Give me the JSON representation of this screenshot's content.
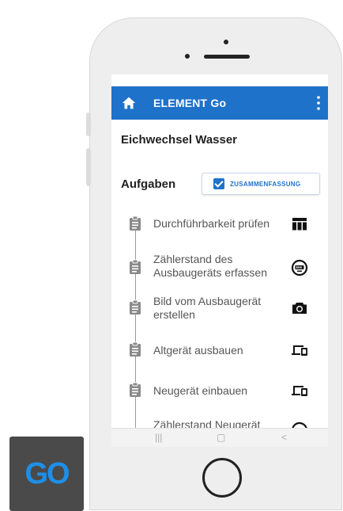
{
  "appbar": {
    "title": "ELEMENT Go"
  },
  "page": {
    "title": "Eichwechsel Wasser"
  },
  "tasks_section": {
    "title": "Aufgaben",
    "summary_button_label": "ZUSAMMENFASSUNG"
  },
  "tasks": [
    {
      "label": "Durchführbarkeit prüfen",
      "icon": "table-icon"
    },
    {
      "label": "Zählerstand des Ausbaugeräts erfassen",
      "icon": "meter-icon"
    },
    {
      "label": "Bild vom Ausbaugerät erstellen",
      "icon": "camera-icon"
    },
    {
      "label": "Altgerät ausbauen",
      "icon": "devices-icon"
    },
    {
      "label": "Neugerät einbauen",
      "icon": "devices-icon"
    },
    {
      "label": "Zählerstand Neugerät",
      "icon": "meter-icon"
    }
  ],
  "navbar": {
    "recents": "|||",
    "home": "▢",
    "back": "<"
  },
  "logo": {
    "text": "GO"
  },
  "colors": {
    "accent": "#1f72c9",
    "logo_bg": "#4a4a4a",
    "logo_text": "#1e8fe8"
  }
}
